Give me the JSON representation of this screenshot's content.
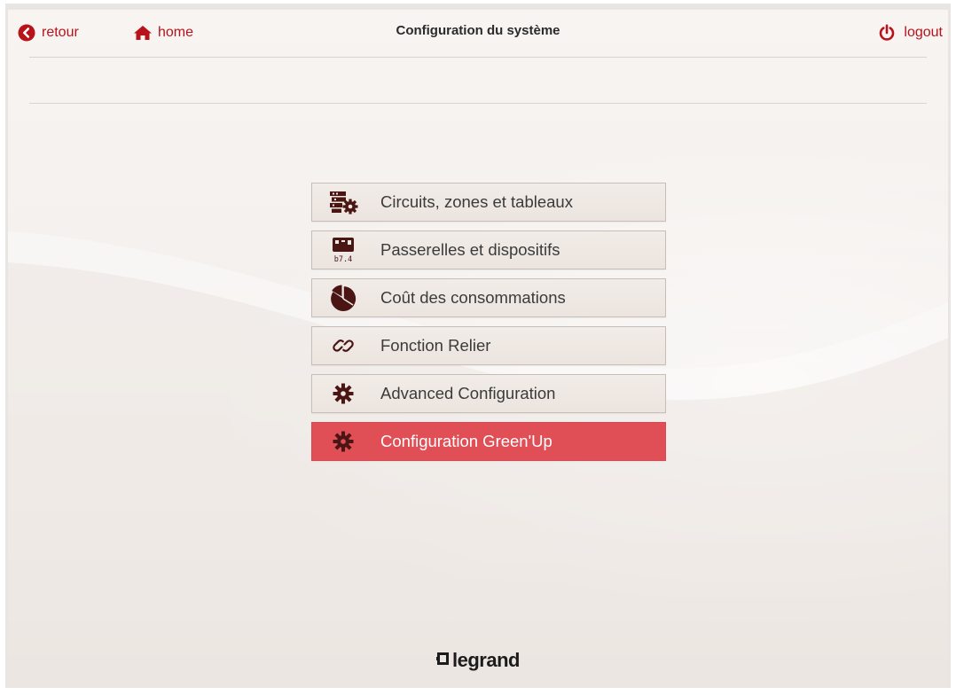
{
  "header": {
    "back_label": "retour",
    "home_label": "home",
    "title": "Configuration du système",
    "logout_label": "logout"
  },
  "menu": {
    "items": [
      {
        "label": "Circuits, zones et tableaux",
        "icon": "circuit-panel-gear-icon"
      },
      {
        "label": "Passerelles et dispositifs",
        "icon": "meter-display-icon",
        "icon_text": "b7.4"
      },
      {
        "label": "Coût des consommations",
        "icon": "pie-chart-icon"
      },
      {
        "label": "Fonction Relier",
        "icon": "link-icon"
      },
      {
        "label": "Advanced Configuration",
        "icon": "gear-icon"
      },
      {
        "label": "Configuration Green'Up",
        "icon": "gear-icon",
        "active": true
      }
    ]
  },
  "footer": {
    "brand": "legrand"
  },
  "colors": {
    "accent": "#b8131a",
    "active_item": "#df4f55",
    "icon_dark": "#4a1512"
  }
}
